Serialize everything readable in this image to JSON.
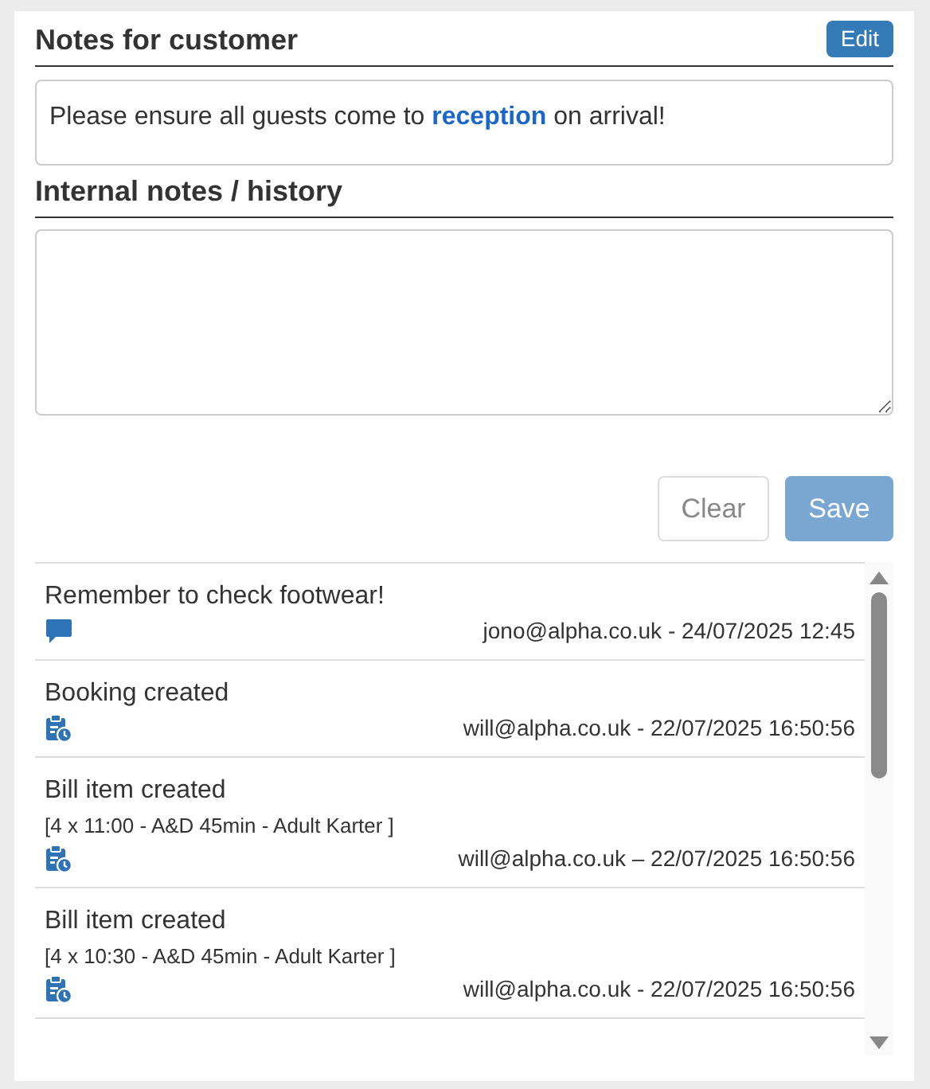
{
  "customer_notes": {
    "title": "Notes for customer",
    "edit_button": "Edit",
    "text": "Please ensure all guests come to **reception** on arrival!"
  },
  "internal_notes": {
    "title": "Internal notes / history",
    "clear_button": {
      "label": "Clear",
      "disabled": false
    },
    "save_button": {
      "label": "Save",
      "disabled": true
    }
  },
  "history": [
    {
      "kind": "note",
      "title": "Remember to check footwear!",
      "meta": "jono@alpha.co.uk - 24/07/2025 12:45"
    },
    {
      "kind": "event",
      "title": "Booking created",
      "meta": "will@alpha.co.uk - 22/07/2025 16:50:56"
    },
    {
      "kind": "event",
      "title": "Bill item created",
      "detail": "[4 x 11:00 - A&D 45min - Adult Karter ]",
      "meta": "will@alpha.co.uk – 22/07/2025 16:50:56"
    },
    {
      "kind": "event",
      "title": "Bill item created",
      "detail": "[4 x 10:30 - A&D 45min - Adult Karter ]",
      "meta": "will@alpha.co.uk - 22/07/2025 16:50:56"
    }
  ]
}
